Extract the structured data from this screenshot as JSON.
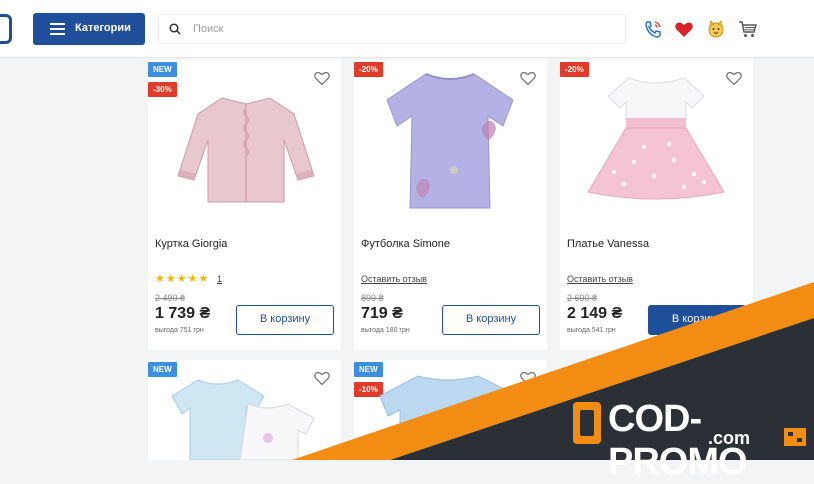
{
  "header": {
    "categories_label": "Категории",
    "search_placeholder": "Поиск"
  },
  "products": [
    {
      "name": "Куртка Giorgia",
      "badges": [
        "NEW",
        "-30%"
      ],
      "rating_count": "1",
      "old_price": "2 490 ₴",
      "price": "1 739 ₴",
      "savings": "выгода 751 грн",
      "cart_label": "В корзину"
    },
    {
      "name": "Футболка Simone",
      "badges": [
        "-20%"
      ],
      "review_link": "Оставить отзыв",
      "old_price": "899 ₴",
      "price": "719 ₴",
      "savings": "выгода 180 грн",
      "cart_label": "В корзину"
    },
    {
      "name": "Платье Vanessa",
      "badges": [
        "-20%"
      ],
      "review_link": "Оставить отзыв",
      "old_price": "2 690 ₴",
      "price": "2 149 ₴",
      "savings": "выгода 541 грн",
      "cart_label": "В корзину"
    },
    {
      "badges": [
        "NEW"
      ]
    },
    {
      "badges": [
        "NEW",
        "-10%"
      ]
    }
  ],
  "watermark": {
    "brand": "COD-PROMO",
    "domain": ".com"
  },
  "colors": {
    "primary": "#1f4e9a",
    "badge_new": "#3c8ee0",
    "badge_sale": "#e33b2a",
    "promo_orange": "#f28c12",
    "promo_dark": "#2b2f36"
  }
}
